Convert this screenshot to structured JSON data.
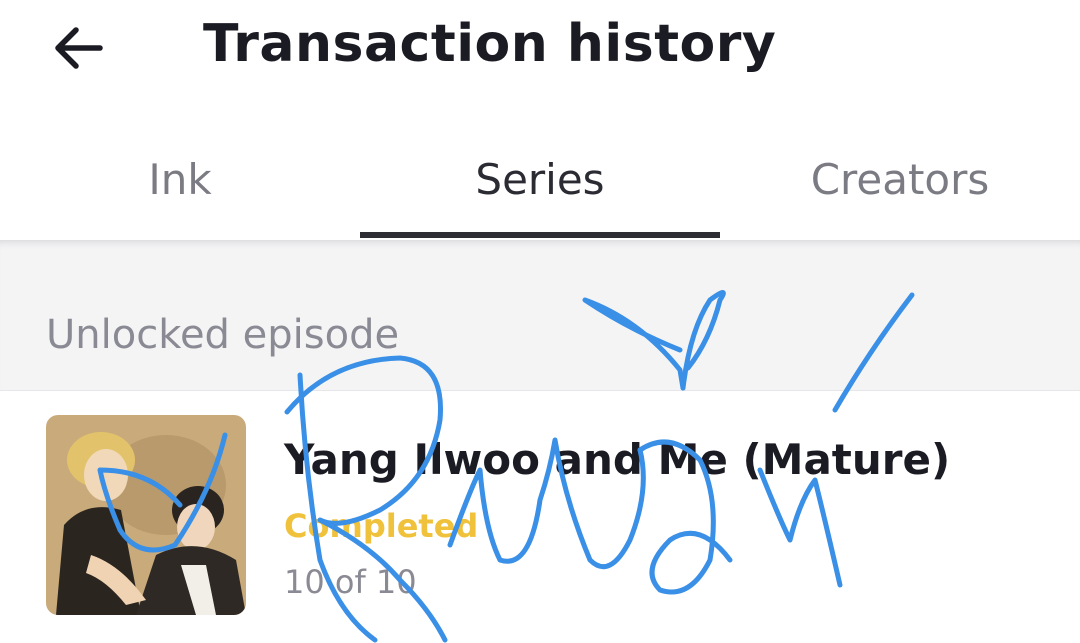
{
  "header": {
    "title": "Transaction history",
    "back_icon": "arrow-left-icon"
  },
  "tabs": [
    {
      "label": "Ink",
      "active": false
    },
    {
      "label": "Series",
      "active": true
    },
    {
      "label": "Creators",
      "active": false
    }
  ],
  "section": {
    "label": "Unlocked episode"
  },
  "items": [
    {
      "title": "Yang Ilwoo and Me (Mature)",
      "status": "Completed",
      "count": "10 of 10"
    }
  ],
  "colors": {
    "title_text": "#1b1b24",
    "tab_inactive": "#7b7b84",
    "tab_underline": "#2d2d33",
    "section_bg": "#f4f4f5",
    "status_completed": "#f0c13a",
    "signature_ink": "#3a8fe6"
  }
}
